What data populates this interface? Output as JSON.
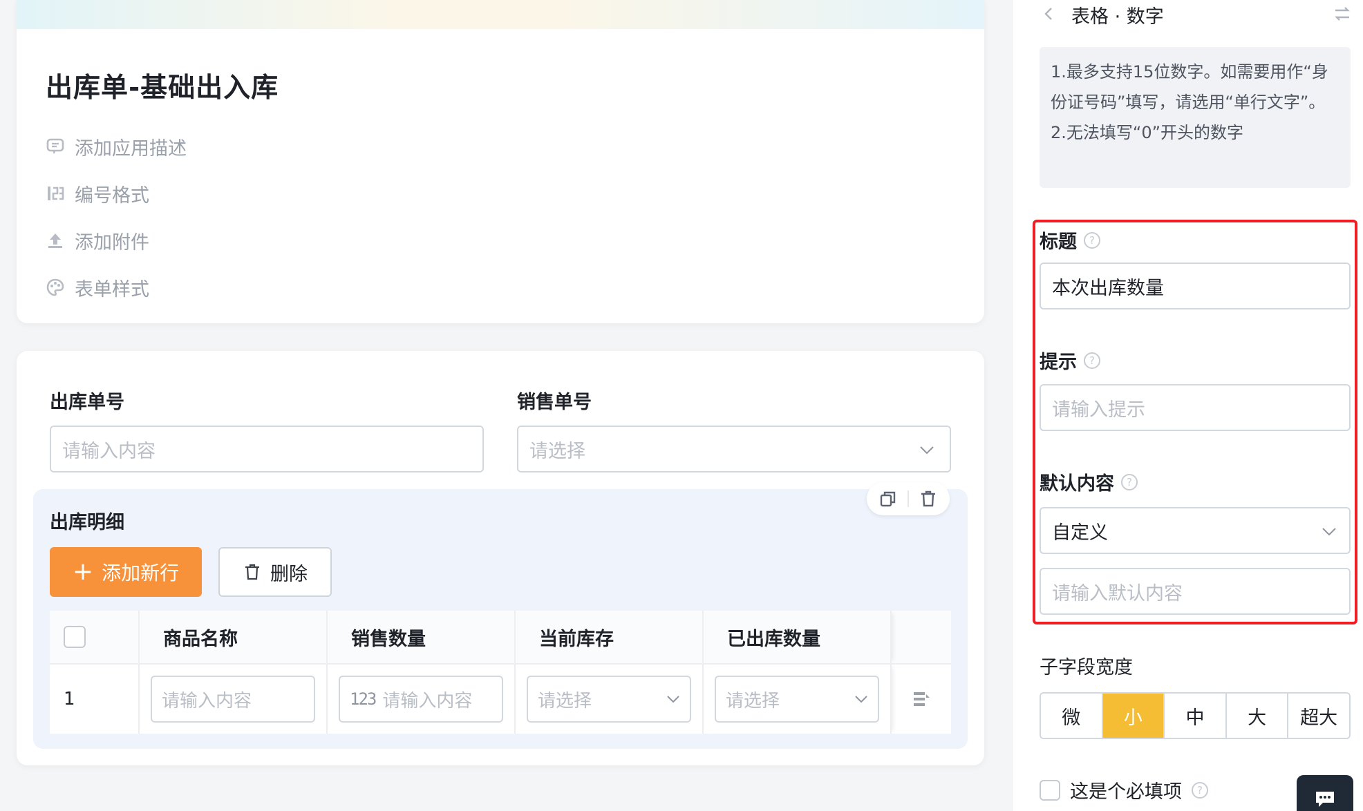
{
  "form": {
    "title": "出库单-基础出入库",
    "meta": [
      {
        "icon": "comment-icon",
        "label": "添加应用描述"
      },
      {
        "icon": "number-format-icon",
        "label": "编号格式"
      },
      {
        "icon": "upload-icon",
        "label": "添加附件"
      },
      {
        "icon": "palette-icon",
        "label": "表单样式"
      }
    ],
    "fields": {
      "order_no": {
        "label": "出库单号",
        "placeholder": "请输入内容"
      },
      "sales_no": {
        "label": "销售单号",
        "placeholder": "请选择"
      }
    },
    "subform": {
      "title": "出库明细",
      "add_button": "添加新行",
      "add_icon": "+",
      "delete_button": "删除",
      "columns": [
        "商品名称",
        "销售数量",
        "当前库存",
        "已出库数量"
      ],
      "rows": [
        {
          "index": "1",
          "product_placeholder": "请输入内容",
          "qty_icon": "123",
          "qty_placeholder": "请输入内容",
          "stock_placeholder": "请选择",
          "shipped_placeholder": "请选择"
        }
      ]
    }
  },
  "panel": {
    "title": "表格 · 数字",
    "tips": [
      "1.最多支持15位数字。如需要用作“身份证号码”填写，请选用“单行文字”。",
      "2.无法填写“0”开头的数字"
    ],
    "title_label": "标题",
    "title_value": "本次出库数量",
    "hint_label": "提示",
    "hint_placeholder": "请输入提示",
    "default_label": "默认内容",
    "default_mode": "自定义",
    "default_placeholder": "请输入默认内容",
    "help_glyph": "?",
    "width_label": "子字段宽度",
    "width_options": [
      "微",
      "小",
      "中",
      "大",
      "超大"
    ],
    "width_selected": "小",
    "required_label": "这是个必填项"
  },
  "colors": {
    "accent_orange": "#f7913a",
    "selected_yellow": "#f5bd34",
    "highlight_red": "#f01e23",
    "subform_bg": "#eef3fc"
  }
}
